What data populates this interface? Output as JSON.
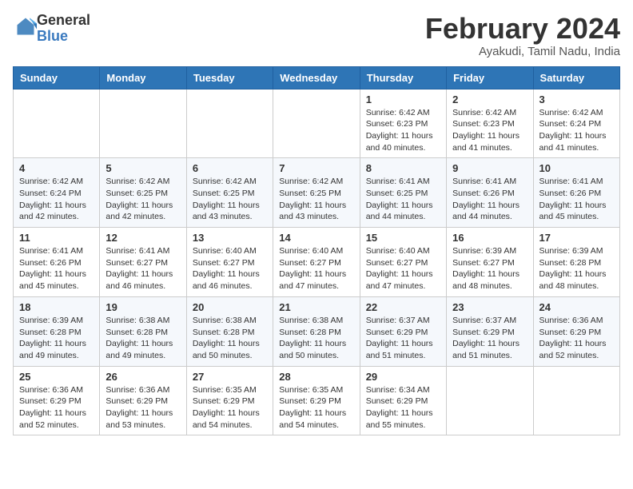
{
  "header": {
    "logo_general": "General",
    "logo_blue": "Blue",
    "month_title": "February 2024",
    "location": "Ayakudi, Tamil Nadu, India"
  },
  "days_of_week": [
    "Sunday",
    "Monday",
    "Tuesday",
    "Wednesday",
    "Thursday",
    "Friday",
    "Saturday"
  ],
  "weeks": [
    [
      {
        "day": "",
        "info": ""
      },
      {
        "day": "",
        "info": ""
      },
      {
        "day": "",
        "info": ""
      },
      {
        "day": "",
        "info": ""
      },
      {
        "day": "1",
        "info": "Sunrise: 6:42 AM\nSunset: 6:23 PM\nDaylight: 11 hours and 40 minutes."
      },
      {
        "day": "2",
        "info": "Sunrise: 6:42 AM\nSunset: 6:23 PM\nDaylight: 11 hours and 41 minutes."
      },
      {
        "day": "3",
        "info": "Sunrise: 6:42 AM\nSunset: 6:24 PM\nDaylight: 11 hours and 41 minutes."
      }
    ],
    [
      {
        "day": "4",
        "info": "Sunrise: 6:42 AM\nSunset: 6:24 PM\nDaylight: 11 hours and 42 minutes."
      },
      {
        "day": "5",
        "info": "Sunrise: 6:42 AM\nSunset: 6:25 PM\nDaylight: 11 hours and 42 minutes."
      },
      {
        "day": "6",
        "info": "Sunrise: 6:42 AM\nSunset: 6:25 PM\nDaylight: 11 hours and 43 minutes."
      },
      {
        "day": "7",
        "info": "Sunrise: 6:42 AM\nSunset: 6:25 PM\nDaylight: 11 hours and 43 minutes."
      },
      {
        "day": "8",
        "info": "Sunrise: 6:41 AM\nSunset: 6:25 PM\nDaylight: 11 hours and 44 minutes."
      },
      {
        "day": "9",
        "info": "Sunrise: 6:41 AM\nSunset: 6:26 PM\nDaylight: 11 hours and 44 minutes."
      },
      {
        "day": "10",
        "info": "Sunrise: 6:41 AM\nSunset: 6:26 PM\nDaylight: 11 hours and 45 minutes."
      }
    ],
    [
      {
        "day": "11",
        "info": "Sunrise: 6:41 AM\nSunset: 6:26 PM\nDaylight: 11 hours and 45 minutes."
      },
      {
        "day": "12",
        "info": "Sunrise: 6:41 AM\nSunset: 6:27 PM\nDaylight: 11 hours and 46 minutes."
      },
      {
        "day": "13",
        "info": "Sunrise: 6:40 AM\nSunset: 6:27 PM\nDaylight: 11 hours and 46 minutes."
      },
      {
        "day": "14",
        "info": "Sunrise: 6:40 AM\nSunset: 6:27 PM\nDaylight: 11 hours and 47 minutes."
      },
      {
        "day": "15",
        "info": "Sunrise: 6:40 AM\nSunset: 6:27 PM\nDaylight: 11 hours and 47 minutes."
      },
      {
        "day": "16",
        "info": "Sunrise: 6:39 AM\nSunset: 6:27 PM\nDaylight: 11 hours and 48 minutes."
      },
      {
        "day": "17",
        "info": "Sunrise: 6:39 AM\nSunset: 6:28 PM\nDaylight: 11 hours and 48 minutes."
      }
    ],
    [
      {
        "day": "18",
        "info": "Sunrise: 6:39 AM\nSunset: 6:28 PM\nDaylight: 11 hours and 49 minutes."
      },
      {
        "day": "19",
        "info": "Sunrise: 6:38 AM\nSunset: 6:28 PM\nDaylight: 11 hours and 49 minutes."
      },
      {
        "day": "20",
        "info": "Sunrise: 6:38 AM\nSunset: 6:28 PM\nDaylight: 11 hours and 50 minutes."
      },
      {
        "day": "21",
        "info": "Sunrise: 6:38 AM\nSunset: 6:28 PM\nDaylight: 11 hours and 50 minutes."
      },
      {
        "day": "22",
        "info": "Sunrise: 6:37 AM\nSunset: 6:29 PM\nDaylight: 11 hours and 51 minutes."
      },
      {
        "day": "23",
        "info": "Sunrise: 6:37 AM\nSunset: 6:29 PM\nDaylight: 11 hours and 51 minutes."
      },
      {
        "day": "24",
        "info": "Sunrise: 6:36 AM\nSunset: 6:29 PM\nDaylight: 11 hours and 52 minutes."
      }
    ],
    [
      {
        "day": "25",
        "info": "Sunrise: 6:36 AM\nSunset: 6:29 PM\nDaylight: 11 hours and 52 minutes."
      },
      {
        "day": "26",
        "info": "Sunrise: 6:36 AM\nSunset: 6:29 PM\nDaylight: 11 hours and 53 minutes."
      },
      {
        "day": "27",
        "info": "Sunrise: 6:35 AM\nSunset: 6:29 PM\nDaylight: 11 hours and 54 minutes."
      },
      {
        "day": "28",
        "info": "Sunrise: 6:35 AM\nSunset: 6:29 PM\nDaylight: 11 hours and 54 minutes."
      },
      {
        "day": "29",
        "info": "Sunrise: 6:34 AM\nSunset: 6:29 PM\nDaylight: 11 hours and 55 minutes."
      },
      {
        "day": "",
        "info": ""
      },
      {
        "day": "",
        "info": ""
      }
    ]
  ]
}
